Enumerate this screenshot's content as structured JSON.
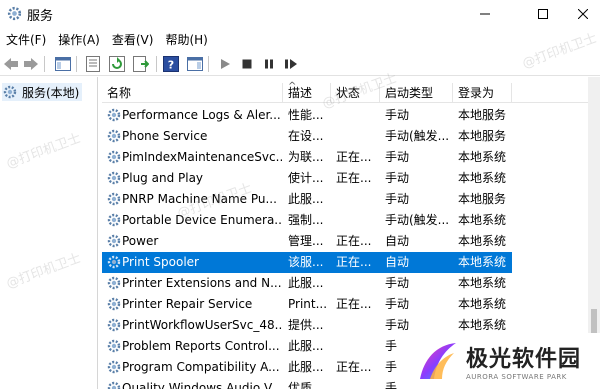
{
  "window": {
    "title": "服务",
    "icon": "services-gear-icon"
  },
  "menu": [
    "文件(F)",
    "操作(A)",
    "查看(V)",
    "帮助(H)"
  ],
  "tree": {
    "root_label": "服务(本地)"
  },
  "columns": {
    "name": "名称",
    "description": "描述",
    "status": "状态",
    "startup_type": "启动类型",
    "logon_as": "登录为"
  },
  "services": [
    {
      "name": "Performance Logs & Aler...",
      "description": "性能...",
      "status": "",
      "startup_type": "手动",
      "logon_as": "本地服务"
    },
    {
      "name": "Phone Service",
      "description": "在设...",
      "status": "",
      "startup_type": "手动(触发...",
      "logon_as": "本地服务"
    },
    {
      "name": "PimIndexMaintenanceSvc...",
      "description": "为联...",
      "status": "正在...",
      "startup_type": "手动",
      "logon_as": "本地系统"
    },
    {
      "name": "Plug and Play",
      "description": "使计...",
      "status": "正在...",
      "startup_type": "手动",
      "logon_as": "本地系统"
    },
    {
      "name": "PNRP Machine Name Pu...",
      "description": "此服...",
      "status": "",
      "startup_type": "手动",
      "logon_as": "本地服务"
    },
    {
      "name": "Portable Device Enumera...",
      "description": "强制...",
      "status": "",
      "startup_type": "手动(触发...",
      "logon_as": "本地系统"
    },
    {
      "name": "Power",
      "description": "管理...",
      "status": "正在...",
      "startup_type": "自动",
      "logon_as": "本地系统"
    },
    {
      "name": "Print Spooler",
      "description": "该服...",
      "status": "正在...",
      "startup_type": "自动",
      "logon_as": "本地系统",
      "selected": true
    },
    {
      "name": "Printer Extensions and N...",
      "description": "此服...",
      "status": "",
      "startup_type": "手动",
      "logon_as": "本地系统"
    },
    {
      "name": "Printer Repair Service",
      "description": "Print...",
      "status": "正在...",
      "startup_type": "手动",
      "logon_as": "本地系统"
    },
    {
      "name": "PrintWorkflowUserSvc_48...",
      "description": "提供...",
      "status": "",
      "startup_type": "手动",
      "logon_as": "本地系统"
    },
    {
      "name": "Problem Reports Control...",
      "description": "此服...",
      "status": "",
      "startup_type": "手",
      "logon_as": ""
    },
    {
      "name": "Program Compatibility A...",
      "description": "此服...",
      "status": "正在...",
      "startup_type": "手",
      "logon_as": ""
    },
    {
      "name": "Quality Windows Audio V...",
      "description": "优质...",
      "status": "",
      "startup_type": "手",
      "logon_as": ""
    }
  ],
  "watermark": "@打印机卫士",
  "logo": {
    "name_cn": "极光软件园",
    "name_en": "AURORA SOFTWARE PARK"
  },
  "colors": {
    "selection": "#0078d7",
    "tree_selection": "#e5f0fb"
  }
}
